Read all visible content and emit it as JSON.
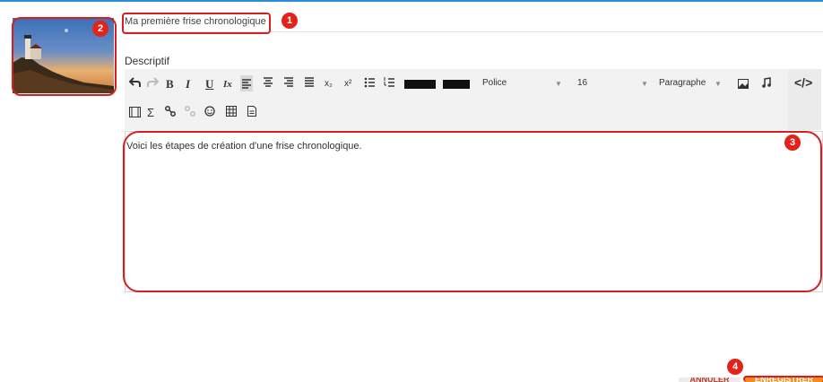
{
  "title_input": {
    "value": "Ma première frise chronologique"
  },
  "description": {
    "label": "Descriptif"
  },
  "toolbar": {
    "undo_icon": "undo-icon",
    "redo_icon": "redo-icon",
    "bold": "B",
    "italic": "I",
    "underline": "U",
    "clear_format": "Ix",
    "subscript": "x₂",
    "superscript": "x²",
    "font_select": "Police",
    "size_select": "16",
    "format_select": "Paragraphe",
    "source_code": "</>",
    "sigma": "Σ",
    "text_color": "#111111",
    "bg_color": "#111111"
  },
  "editor": {
    "content": "Voici les étapes de création d'une frise chronologique."
  },
  "markers": {
    "m1": "1",
    "m2": "2",
    "m3": "3",
    "m4": "4"
  },
  "buttons": {
    "cancel": "ANNULER",
    "save": "ENREGISTRER"
  },
  "colors": {
    "accent": "#2a8fd6",
    "marker": "#d42020",
    "save_bg": "#f48a1c"
  }
}
